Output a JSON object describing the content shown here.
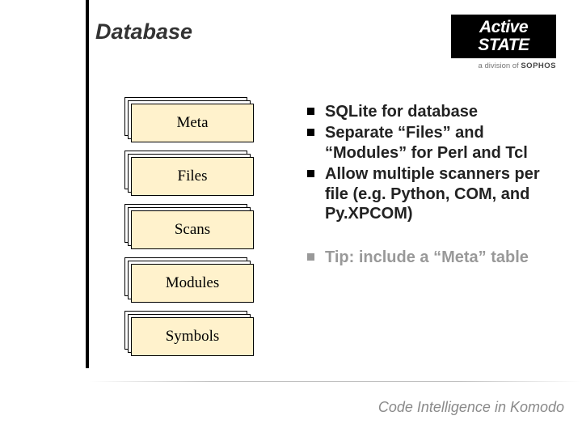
{
  "title": "Database",
  "logo": {
    "line1": "Active",
    "line2": "STATE",
    "subPrefix": "a division of ",
    "subBrand": "SOPHOS"
  },
  "boxes": [
    "Meta",
    "Files",
    "Scans",
    "Modules",
    "Symbols"
  ],
  "bullets": [
    "SQLite for database",
    "Separate “Files” and “Modules” for Perl and Tcl",
    "Allow multiple scanners per file (e.g. Python, COM, and Py.XPCOM)"
  ],
  "tip": "Tip: include a “Meta” table",
  "footer": "Code Intelligence in Komodo"
}
